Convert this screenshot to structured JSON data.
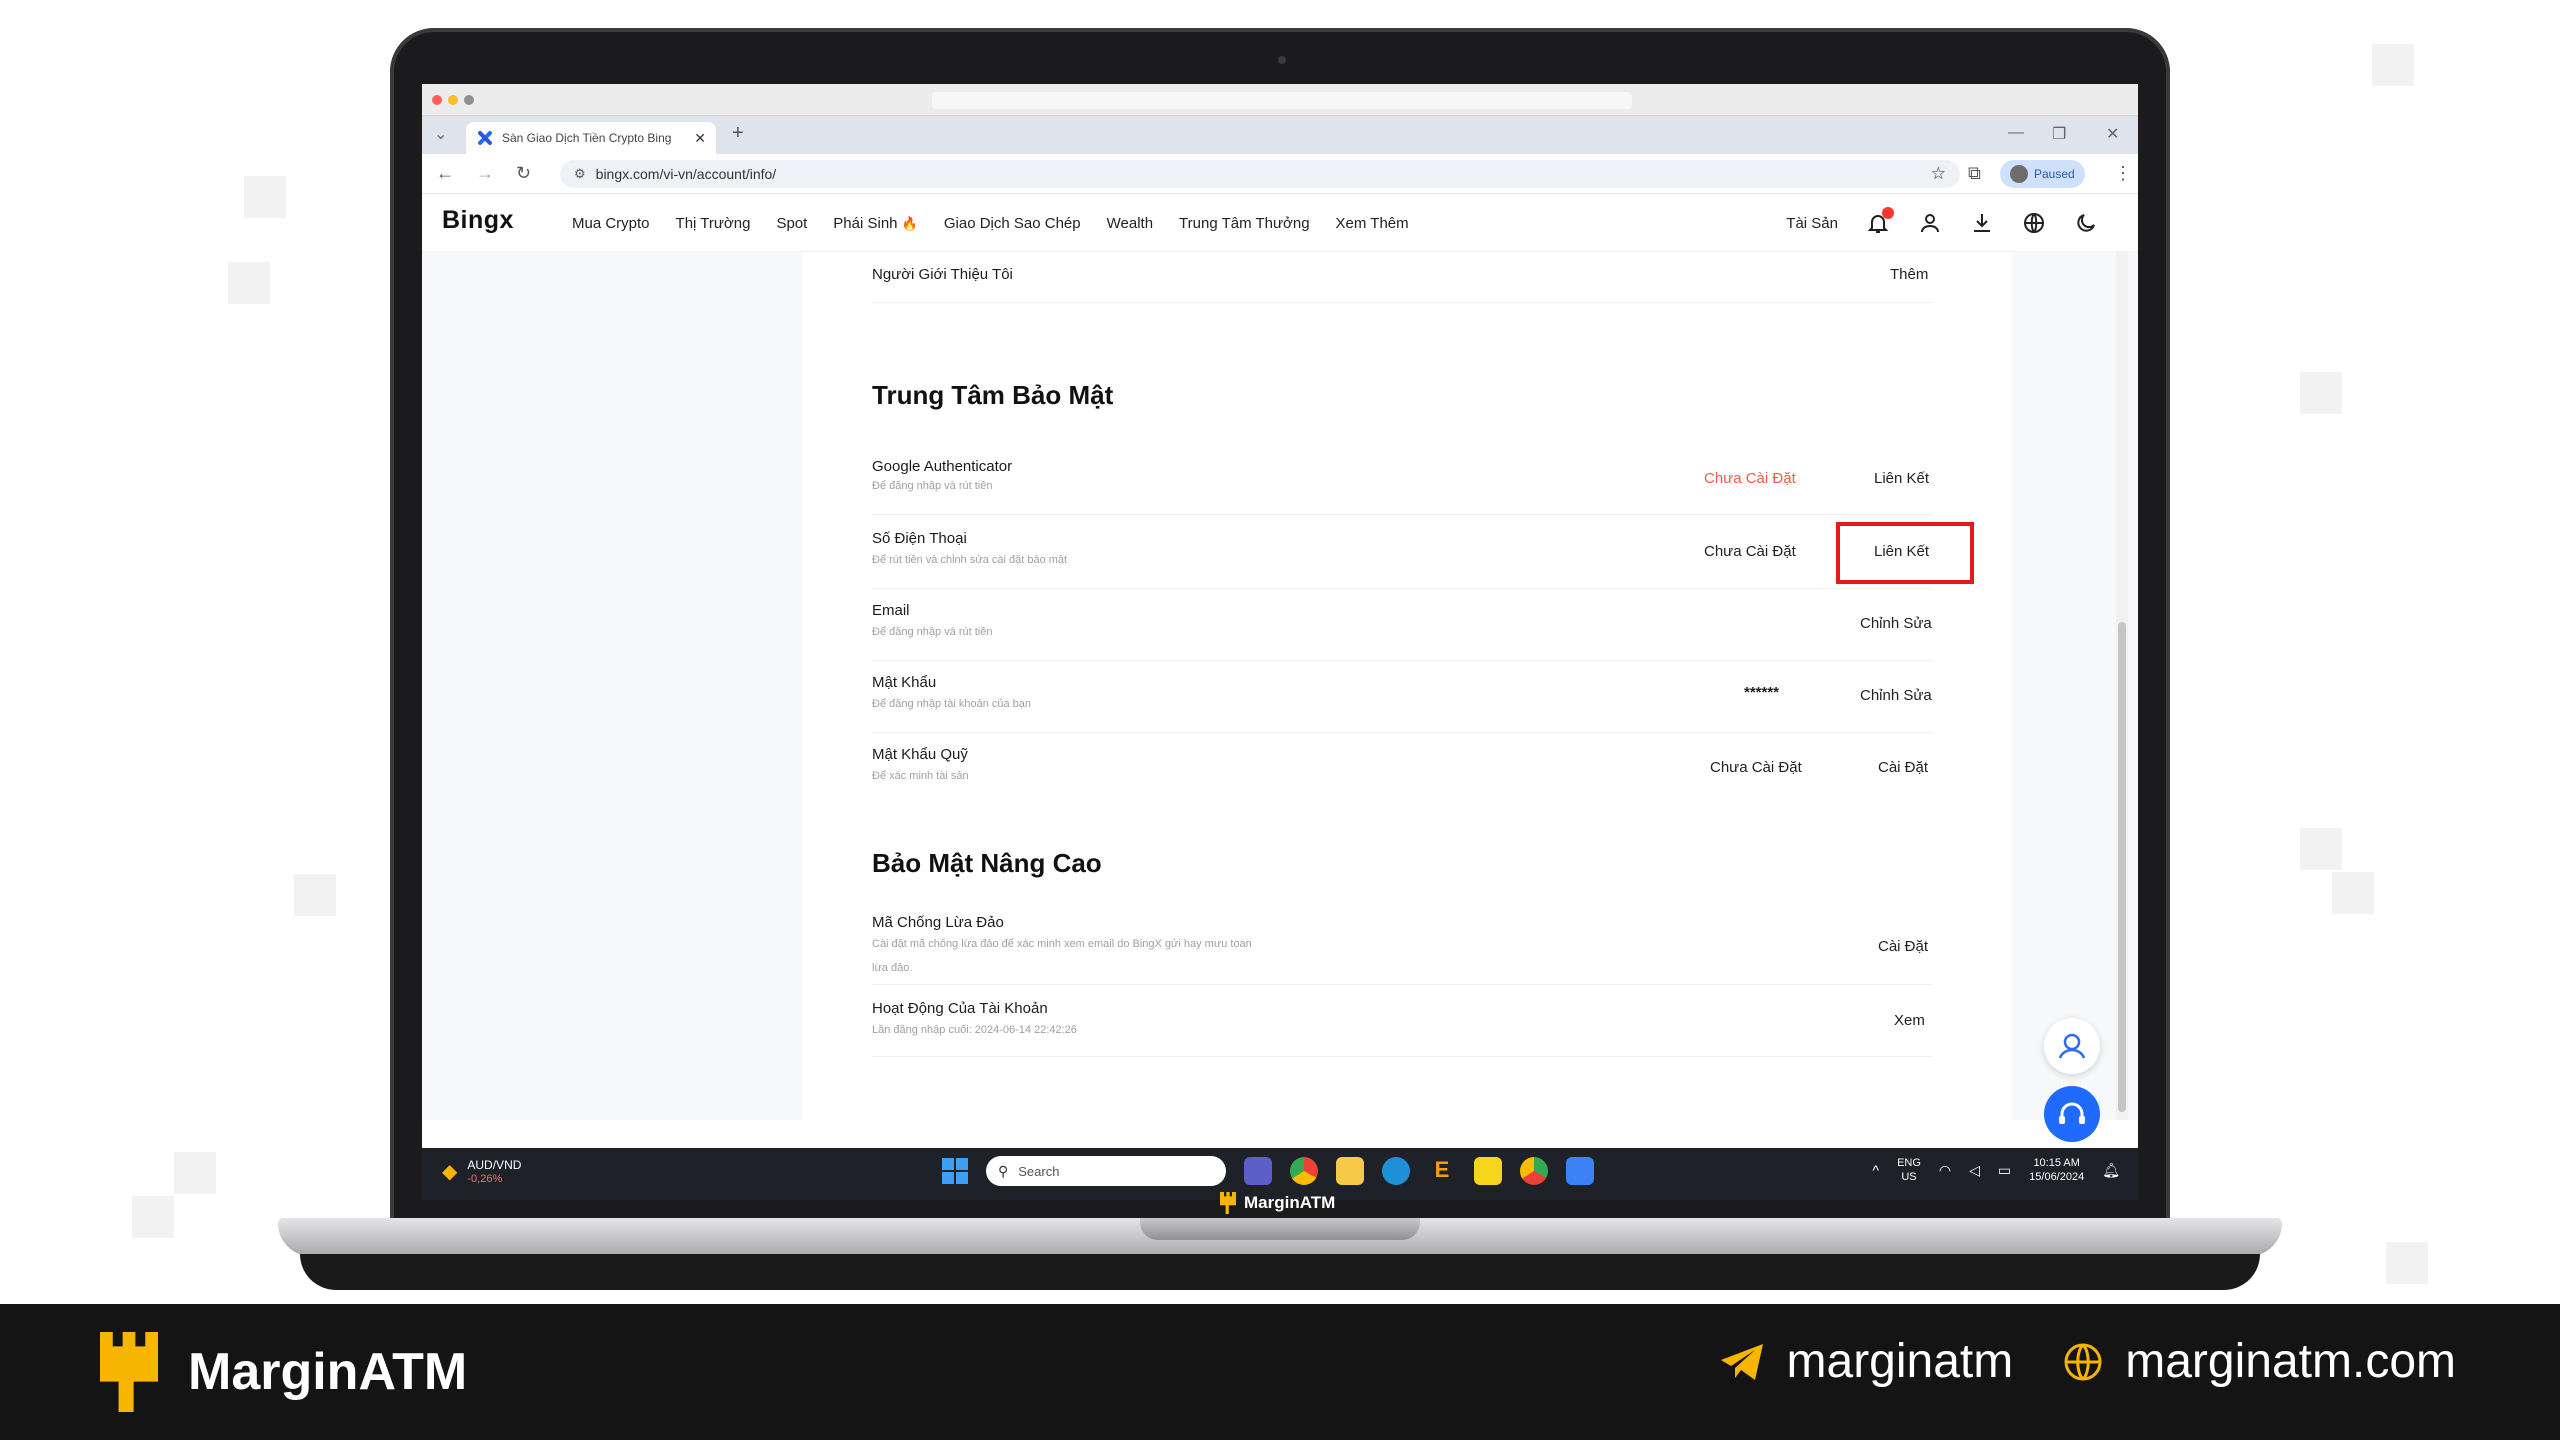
{
  "browser": {
    "tab_title": "Sàn Giao Dịch Tiền Crypto Bing",
    "url": "bingx.com/vi-vn/account/info/",
    "profile_label": "Paused"
  },
  "site_nav": {
    "brand": "Bingx",
    "menu": [
      "Mua Crypto",
      "Thị Trường",
      "Spot",
      "Phái Sinh",
      "Giao Dịch Sao Chép",
      "Wealth",
      "Trung Tâm Thưởng",
      "Xem Thêm"
    ],
    "assets_label": "Tài Sản"
  },
  "referrer_row": {
    "label": "Người Giới Thiệu Tôi",
    "action": "Thêm"
  },
  "security_center": {
    "heading": "Trung Tâm Bảo Mật",
    "rows": [
      {
        "title": "Google Authenticator",
        "desc": "Để đăng nhập và rút tiền",
        "status": "Chưa Cài Đặt",
        "action": "Liên Kết"
      },
      {
        "title": "Số Điện Thoại",
        "desc": "Để rút tiền và chỉnh sửa cài đặt bảo mật",
        "status": "Chưa Cài Đặt",
        "action": "Liên Kết"
      },
      {
        "title": "Email",
        "desc": "Để đăng nhập và rút tiền",
        "status": "",
        "action": "Chỉnh Sửa"
      },
      {
        "title": "Mật Khẩu",
        "desc": "Để đăng nhập tài khoản của bạn",
        "status": "******",
        "action": "Chỉnh Sửa"
      },
      {
        "title": "Mật Khẩu Quỹ",
        "desc": "Để xác minh tài sản",
        "status": "Chưa Cài Đặt",
        "action": "Cài Đặt"
      }
    ]
  },
  "advanced_security": {
    "heading": "Bảo Mật Nâng Cao",
    "rows": [
      {
        "title": "Mã Chống Lừa Đảo",
        "desc": "Cài đặt mã chống lừa đảo để xác minh xem email do BingX gửi hay mưu toan",
        "desc2": "lừa đảo.",
        "action": "Cài Đặt"
      },
      {
        "title": "Hoạt Động Của Tài Khoản",
        "desc": "Lần đăng nhập cuối: 2024-06-14 22:42:26",
        "action": "Xem"
      }
    ]
  },
  "taskbar": {
    "ticker": "AUD/VND",
    "ticker_change": "-0,26%",
    "search_placeholder": "Search",
    "lang": "ENG",
    "region": "US",
    "time": "10:15 AM",
    "date": "15/06/2024"
  },
  "laptop_label": "MarginATM",
  "footer": {
    "brand": "MarginATM",
    "telegram": "marginatm",
    "website": "marginatm.com"
  },
  "colors": {
    "accent_red": "#e31b1b",
    "status_red": "#f05a4b",
    "brand_yellow": "#f7b500",
    "support_blue": "#1f6bff"
  }
}
